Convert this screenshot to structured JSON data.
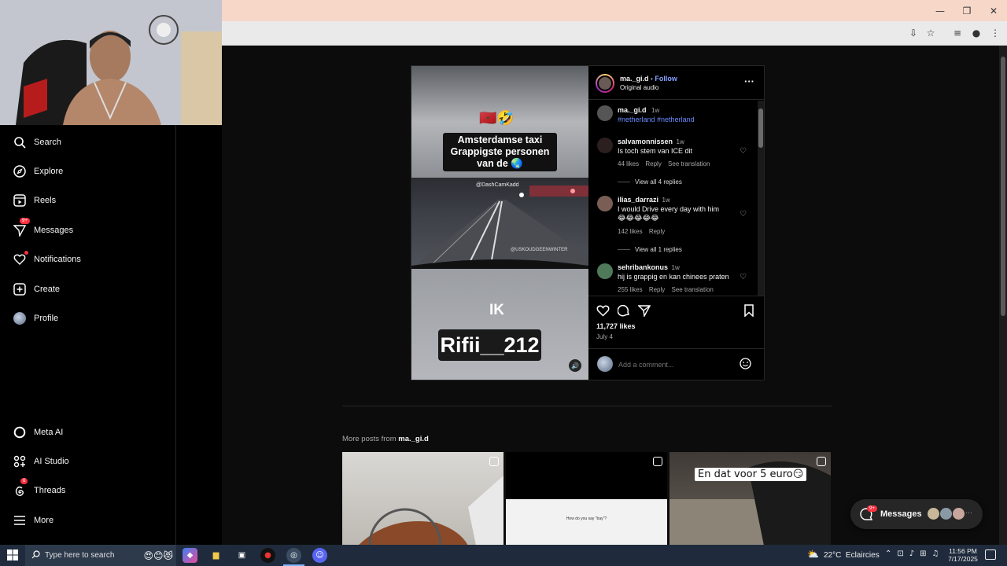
{
  "sidebar": {
    "items": [
      {
        "label": "Search",
        "icon": "search-icon"
      },
      {
        "label": "Explore",
        "icon": "compass-icon"
      },
      {
        "label": "Reels",
        "icon": "reels-icon"
      },
      {
        "label": "Messages",
        "icon": "send-icon",
        "badge": "9+"
      },
      {
        "label": "Notifications",
        "icon": "heart-icon",
        "dot": true
      },
      {
        "label": "Create",
        "icon": "plus-square-icon"
      },
      {
        "label": "Profile",
        "icon": "profile-avatar"
      }
    ],
    "bottom_items": [
      {
        "label": "Meta AI",
        "icon": "meta-ai-icon"
      },
      {
        "label": "AI Studio",
        "icon": "ai-studio-icon"
      },
      {
        "label": "Threads",
        "icon": "threads-icon",
        "badge": "6"
      },
      {
        "label": "More",
        "icon": "menu-icon"
      }
    ]
  },
  "post": {
    "username": "ma._gi.d",
    "follow": "Follow",
    "separator": "•",
    "audio": "Original audio",
    "media": {
      "flags": "🇲🇦🤣",
      "caption_line1": "Amsterdamse taxi",
      "caption_line2": "Grappigste personen",
      "caption_line3": "van de 🌏",
      "watermark1": "@DashCamKadd",
      "watermark2": "@USKOUDGEENWINTER",
      "ik": "IK",
      "name_tag": "Rifii__212"
    },
    "caption": {
      "user": "ma._gi.d",
      "time": "1w",
      "text": "#netherland #netherland"
    },
    "comments": [
      {
        "user": "salvamonnissen",
        "time": "1w",
        "text": "Is toch stem van ICE dit",
        "likes": "44 likes",
        "reply": "Reply",
        "translate": "See translation",
        "view_replies": "View all 4 replies"
      },
      {
        "user": "ilias_darrazi",
        "time": "1w",
        "text": "I would Drive every day with him",
        "text2": "😂😂😂😂😂",
        "likes": "142 likes",
        "reply": "Reply",
        "view_replies": "View all 1 replies"
      },
      {
        "user": "sehribankonus",
        "time": "1w",
        "text": "hij is grappig en kan chinees praten",
        "likes": "255 likes",
        "reply": "Reply",
        "translate": "See translation"
      }
    ],
    "like_count": "11,727 likes",
    "date": "July 4",
    "comment_placeholder": "Add a comment..."
  },
  "more_posts": {
    "label": "More posts from",
    "user": "ma._gi.d",
    "thumb2_text": "How do you say \"bay\"?",
    "thumb3_text": "En dat voor 5 euro😏"
  },
  "messages_pill": {
    "label": "Messages",
    "badge": "9+"
  },
  "taskbar": {
    "search_placeholder": "Type here to search",
    "weather": "22°C  Eclaircies",
    "time": "11:56 PM",
    "date": "7/17/2025"
  },
  "colors": {
    "accent": "#0095f6",
    "link": "#e0f1ff",
    "badge": "#ff3040"
  }
}
